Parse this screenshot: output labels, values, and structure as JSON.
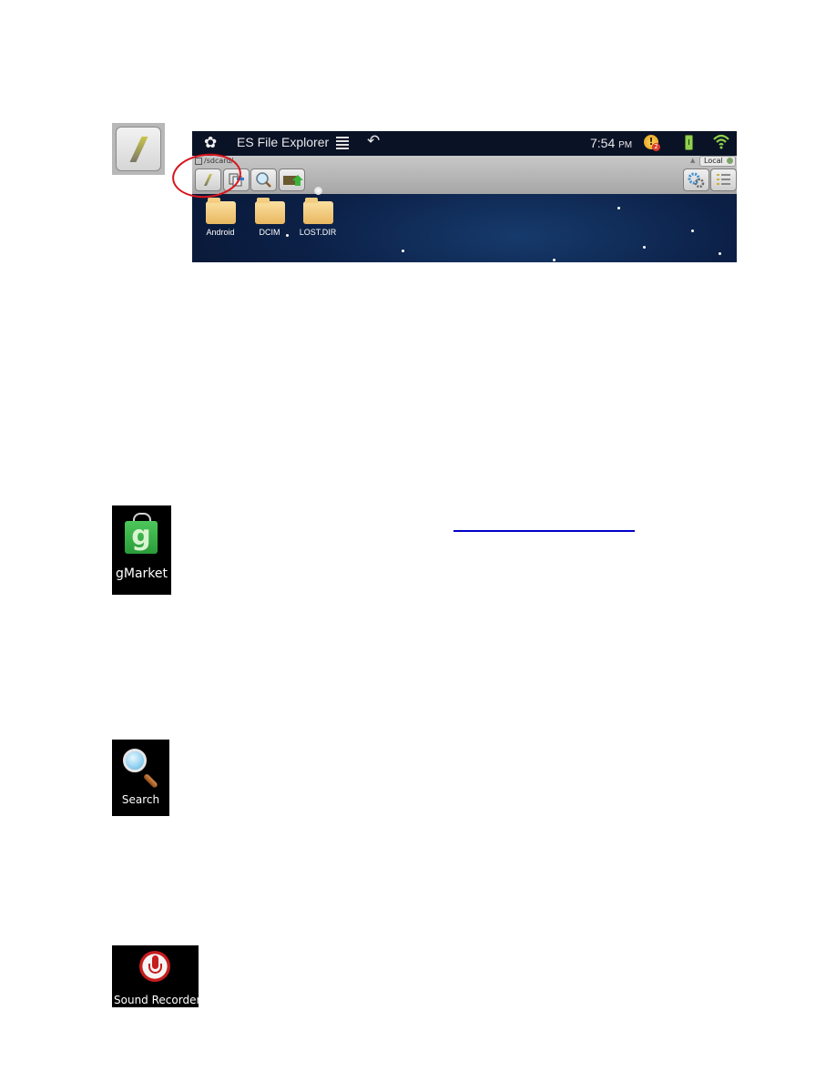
{
  "standalone_icons": {
    "up_button": {
      "icon": "up-directory-slash-icon"
    }
  },
  "es_screenshot": {
    "status_bar": {
      "app_title": "ES File Explorer",
      "app_logo_icon": "es-logo-icon",
      "menu_icon": "menu-icon",
      "back_icon": "back-arrow-icon",
      "time": "7:54",
      "ampm": "PM",
      "alert_icon_glyph": "!",
      "alert_badge": "2",
      "battery_icon": "battery-icon",
      "wifi_icon": "wifi-icon"
    },
    "toolbar": {
      "path": "/sdcard/",
      "local_tab": "Local",
      "buttons": [
        {
          "name": "up-directory-button",
          "icon": "slash-icon"
        },
        {
          "name": "multi-select-button",
          "icon": "copy-windows-icon"
        },
        {
          "name": "search-button",
          "icon": "magnifier-icon"
        },
        {
          "name": "new-folder-button",
          "icon": "folder-arrow-icon"
        }
      ],
      "right_buttons": [
        {
          "name": "settings-button",
          "icon": "gears-icon"
        },
        {
          "name": "view-list-button",
          "icon": "list-icon"
        }
      ]
    },
    "folders": [
      {
        "label": "Android"
      },
      {
        "label": "DCIM"
      },
      {
        "label": "LOST.DIR"
      }
    ]
  },
  "app_icons": {
    "gmarket": {
      "label": "gMarket",
      "glyph": "g"
    },
    "search": {
      "label": "Search"
    },
    "sound_recorder": {
      "label": "Sound Recorder"
    }
  },
  "colors": {
    "highlight_circle": "#d8141c",
    "link_underline": "#0000c8"
  }
}
